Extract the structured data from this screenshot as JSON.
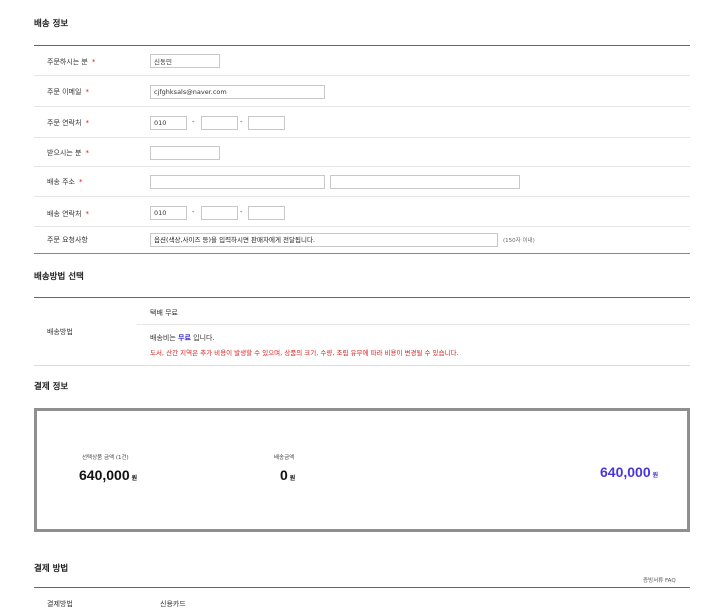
{
  "order_info": {
    "title": "배송 정보",
    "orderer": {
      "label": "주문하시는 분",
      "value": "신동민"
    },
    "email": {
      "label": "주문 이메일",
      "value": "cjfghksals@naver.com"
    },
    "order_phone": {
      "label": "주문 연락처",
      "part1": "010",
      "part2": "",
      "part3": "",
      "sep": "-"
    },
    "receiver": {
      "label": "받으시는 분",
      "value": ""
    },
    "address": {
      "label": "배송 주소",
      "value1": "",
      "value2": ""
    },
    "ship_phone": {
      "label": "배송 연락처",
      "part1": "010",
      "part2": "",
      "part3": "",
      "sep": "-"
    },
    "request": {
      "label": "주문 요청사항",
      "placeholder": "옵션(색상,사이즈 등)을 입력하시면 판매자에게 전달됩니다.",
      "limit": "(150자 이내)"
    },
    "required_mark": "*"
  },
  "shipping_method": {
    "title": "배송방법 선택",
    "label": "배송방법",
    "option": "택배 무료",
    "fee_prefix": "배송비는",
    "fee_value": "무료",
    "fee_suffix": "입니다.",
    "warning": "도서, 산간 지역은 추가 비용이 발생할 수 있으며, 상품의 크기, 수량, 조립 유무에 따라 비용이 변경될 수 있습니다."
  },
  "payment_info": {
    "title": "결제 정보",
    "product_label": "선택상품 금액 (1건)",
    "product_amount": "640,000",
    "shipping_label": "배송금액",
    "shipping_amount": "0",
    "total_amount": "640,000",
    "currency": "원"
  },
  "payment_method": {
    "title": "결제 방법",
    "faq": "증빙서류 FAQ",
    "label": "결제방법",
    "value": "신용카드"
  },
  "colors": {
    "accent": "#4a35d8",
    "required": "#d92020"
  }
}
